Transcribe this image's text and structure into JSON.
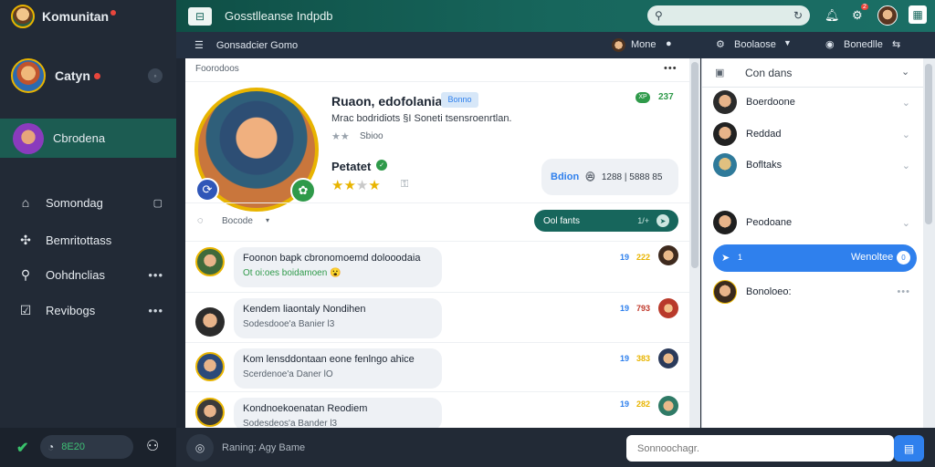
{
  "sidebar": {
    "brand": "Komunitan",
    "user": {
      "name": "Catyn"
    },
    "active_item": {
      "label": "Cbrodena"
    },
    "items": [
      {
        "label": "Somondag",
        "icon": "home-icon"
      },
      {
        "label": "Bemritottass",
        "icon": "puzzle-icon"
      },
      {
        "label": "Oohdnclias",
        "icon": "profile-search-icon"
      },
      {
        "label": "Revibogs",
        "icon": "checkbox-icon"
      }
    ],
    "status_value": "8E20"
  },
  "topbar": {
    "title": "Gosstlleanse Indpdb",
    "notification_count": "2"
  },
  "subbar": {
    "left": "Gonsadcier Gomo",
    "user_label": "Mone",
    "dropdown_label": "Boolaose",
    "right_label": "Bonedlle"
  },
  "profile": {
    "header": "Foorodoos",
    "name": "Ruaon, edofolania",
    "badge": "Bonno",
    "level_pill": "XP",
    "level_value": "237",
    "description": "Mrac bodridiots §I Soneti tsensroenrtlan.",
    "rating_text": "Sbioo",
    "section_label": "Petatet",
    "stars_value": "3.5",
    "stat_label": "Bdion",
    "stat_value": "1288 | 5888 85",
    "filter_label": "Bocode",
    "action_label": "Ool fants",
    "action_suffix": "1/+"
  },
  "messages": [
    {
      "title": "Foonon bapk cbronomoemd dolooodaia",
      "sub": "Ot oi:oes boidamoen",
      "emoji": "😮",
      "num1": "19",
      "num2": "222",
      "sub_color": "#2f9a4a"
    },
    {
      "title": "Kendem liaontaly Nondihen",
      "sub": "Sodesdooe'a Banier l3",
      "emoji": "",
      "num1": "19",
      "num2": "793",
      "sub_color": "#59636e"
    },
    {
      "title": "Kom lensddontaan eone fenlngo ahice",
      "sub": "Scerdenoe'a Daner lO",
      "emoji": "",
      "num1": "19",
      "num2": "383",
      "sub_color": "#59636e"
    },
    {
      "title": "Kondnoekoenatan Reodiem",
      "sub": "Sodesdeos'a Bander l3",
      "emoji": "",
      "num1": "19",
      "num2": "282",
      "sub_color": "#59636e"
    }
  ],
  "rightpanel": {
    "title": "Con dans",
    "contacts": [
      {
        "name": "Boerdoone"
      },
      {
        "name": "Reddad"
      },
      {
        "name": "Bofltaks"
      },
      {
        "name": "Peodoane"
      }
    ],
    "active": {
      "label": "Wenoltee",
      "count": "0",
      "left": "1"
    },
    "last": {
      "name": "Bonoloeo:"
    }
  },
  "bottombar": {
    "left_placeholder": "Raning: Agy Bame",
    "input_placeholder": "Sonnoochagr."
  },
  "colors": {
    "sidebar": "#222a36",
    "accent_teal": "#17665c",
    "accent_blue": "#2f80ed",
    "gold": "#e8b400"
  }
}
